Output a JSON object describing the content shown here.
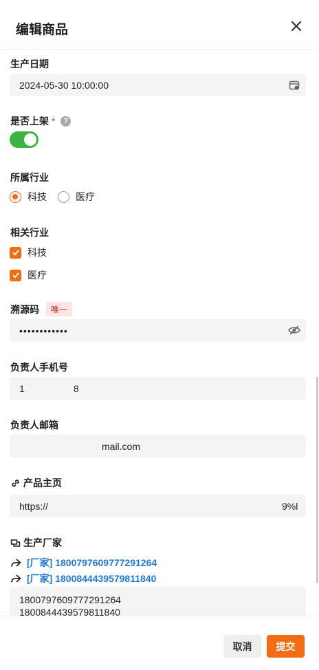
{
  "header": {
    "title": "编辑商品"
  },
  "fields": {
    "production_date": {
      "label": "生产日期",
      "value": "2024-05-30 10:00:00"
    },
    "listed": {
      "label": "是否上架",
      "required_mark": "*",
      "help": "?",
      "on": true
    },
    "industry": {
      "label": "所属行业",
      "options": [
        "科技",
        "医疗"
      ],
      "selected": "科技"
    },
    "related_industry": {
      "label": "相关行业",
      "options": [
        "科技",
        "医疗"
      ],
      "checked": [
        "科技",
        "医疗"
      ]
    },
    "trace_code": {
      "label": "溯源码",
      "tag": "唯一",
      "value": "••••••••••••"
    },
    "manager_phone": {
      "label": "负责人手机号",
      "value_start": "1",
      "value_end": "8"
    },
    "manager_email": {
      "label": "负责人邮箱",
      "value": "mail.com"
    },
    "homepage": {
      "label": "产品主页",
      "value_start": "https://",
      "value_end": "9%l"
    },
    "manufacturer": {
      "label": "生产厂家",
      "links": [
        "[厂家] 1800797609777291264",
        "[厂家] 1800844439579811840"
      ],
      "ids": [
        "1800797609777291264",
        "1800844439579811840"
      ]
    }
  },
  "footer": {
    "cancel": "取消",
    "submit": "提交"
  },
  "colors": {
    "accent": "#f36c12",
    "toggle_on": "#3fb33f",
    "link": "#1f78d1",
    "tag_bg": "#fde5e5",
    "tag_text": "#c0392b"
  }
}
